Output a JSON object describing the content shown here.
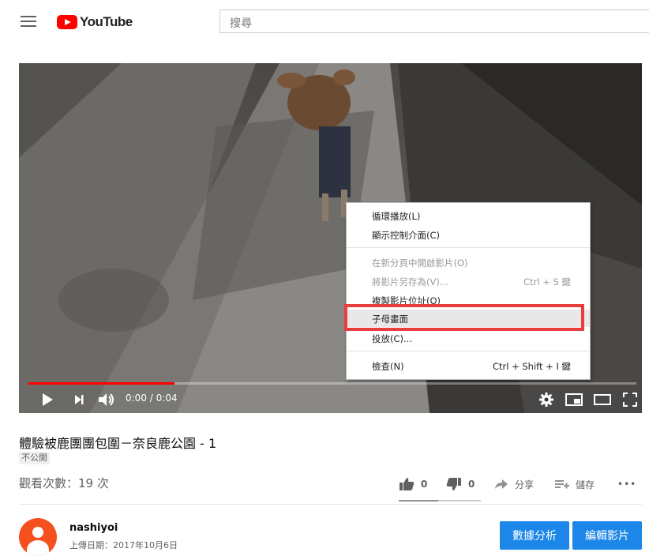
{
  "header": {
    "logo_text": "YouTube",
    "search_placeholder": "搜尋"
  },
  "player": {
    "current_time": "0:00",
    "separator": "/",
    "duration": "0:04",
    "progress_fraction": 0.24
  },
  "context_menu": {
    "items": [
      {
        "label": "循環播放(L)",
        "shortcut": "",
        "disabled": false
      },
      {
        "label": "顯示控制介面(C)",
        "shortcut": "",
        "disabled": false
      },
      {
        "label": "在新分頁中開啟影片(O)",
        "shortcut": "",
        "disabled": true
      },
      {
        "label": "將影片另存為(V)...",
        "shortcut": "Ctrl + S 鍵",
        "disabled": true
      },
      {
        "label": "複製影片位址(O)",
        "shortcut": "",
        "disabled": false
      },
      {
        "label": "子母畫面",
        "shortcut": "",
        "disabled": false
      },
      {
        "label": "投放(C)...",
        "shortcut": "",
        "disabled": false
      },
      {
        "label": "檢查(N)",
        "shortcut": "Ctrl + Shift + I 鍵",
        "disabled": false
      }
    ]
  },
  "video": {
    "title": "體驗被鹿團團包圍－奈良鹿公園 - 1",
    "visibility_badge": "不公開",
    "views": "觀看次數：19 次",
    "likes": "0",
    "dislikes": "0",
    "share_label": "分享",
    "save_label": "儲存",
    "more_label": "•••"
  },
  "channel": {
    "name": "nashiyoi",
    "upload_date": "上傳日期：2017年10月6日"
  },
  "buttons": {
    "analytics": "數據分析",
    "edit_video": "編輯影片"
  },
  "colors": {
    "brand_red": "#ff0000",
    "highlight_border": "#e83e3e",
    "button_blue": "#1c87e8",
    "avatar": "#f4511e"
  }
}
